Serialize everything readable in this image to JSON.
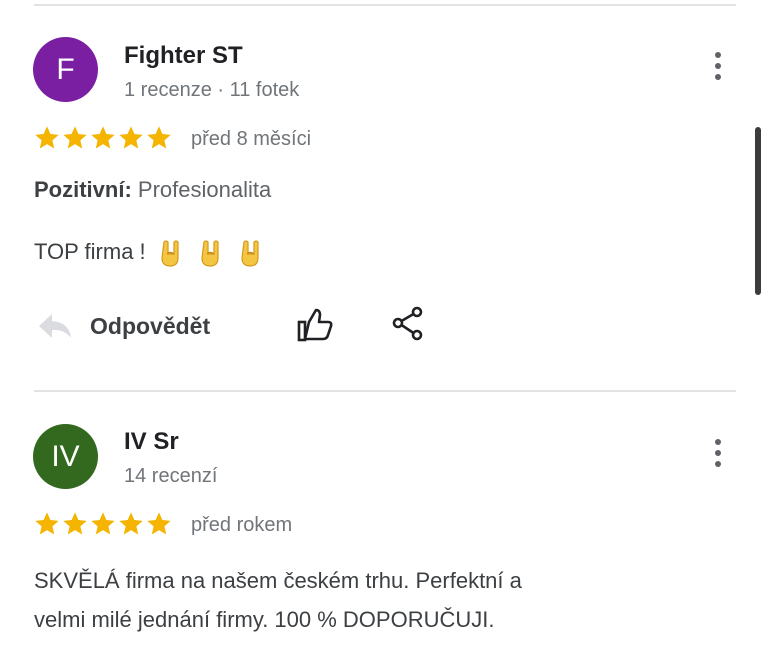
{
  "reviews": [
    {
      "avatar_letter": "F",
      "avatar_color": "#7b1fa2",
      "author": "Fighter ST",
      "meta": "1 recenze · 11 fotek",
      "rating": 5,
      "time": "před 8 měsíci",
      "aspect_label": "Pozitivní:",
      "aspect_value": "Profesionalita",
      "text": "TOP firma !",
      "emoji": [
        "sign-of-the-horns",
        "sign-of-the-horns",
        "sign-of-the-horns"
      ],
      "reply_label": "Odpovědět"
    },
    {
      "avatar_letter": "IV",
      "avatar_color": "#33691e",
      "author": "IV Sr",
      "meta": "14 recenzí",
      "rating": 5,
      "time": "před rokem",
      "text_line1": "SKVĚLÁ firma na našem českém trhu. Perfektní a",
      "text_line2": "velmi milé jednání firmy. 100 % DOPORUČUJI."
    }
  ],
  "colors": {
    "star": "#f4b400",
    "divider": "#e3e3e3",
    "secondary_text": "#70757a"
  },
  "icons": {
    "more": "more-vert-icon",
    "reply": "reply-arrow-icon",
    "like": "thumb-up-icon",
    "share": "share-icon"
  }
}
